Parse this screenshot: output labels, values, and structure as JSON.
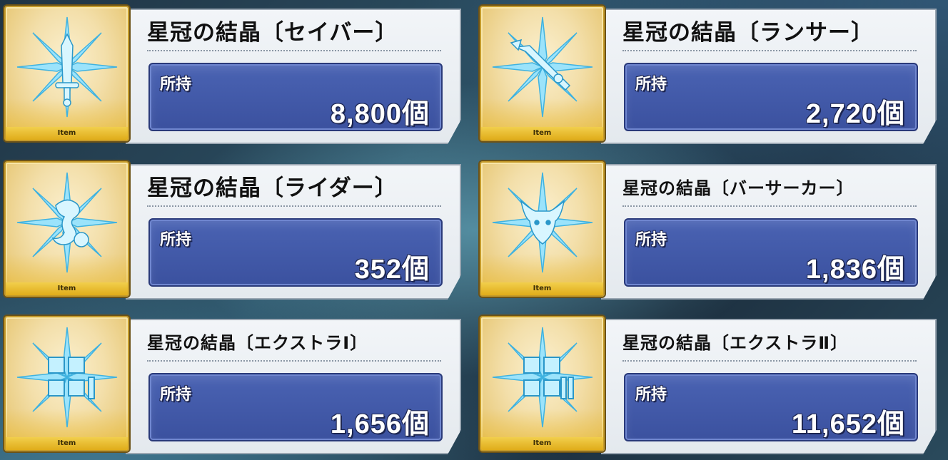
{
  "owned_label": "所持",
  "item_label": "Item",
  "items": [
    {
      "name": "星冠の結晶〔セイバー〕",
      "count": "8,800個",
      "icon": "saber-crystal-icon"
    },
    {
      "name": "星冠の結晶〔ランサー〕",
      "count": "2,720個",
      "icon": "lancer-crystal-icon"
    },
    {
      "name": "星冠の結晶〔ライダー〕",
      "count": "352個",
      "icon": "rider-crystal-icon"
    },
    {
      "name": "星冠の結晶〔バーサーカー〕",
      "count": "1,836個",
      "icon": "berserker-crystal-icon"
    },
    {
      "name": "星冠の結晶〔エクストラⅠ〕",
      "count": "1,656個",
      "icon": "extra-1-crystal-icon"
    },
    {
      "name": "星冠の結晶〔エクストラⅡ〕",
      "count": "11,652個",
      "icon": "extra-2-crystal-icon"
    }
  ],
  "colors": {
    "frame_gold": "#c49a2a",
    "count_box_blue": "#3b519f",
    "crystal_blue": "#7fd8f5"
  }
}
